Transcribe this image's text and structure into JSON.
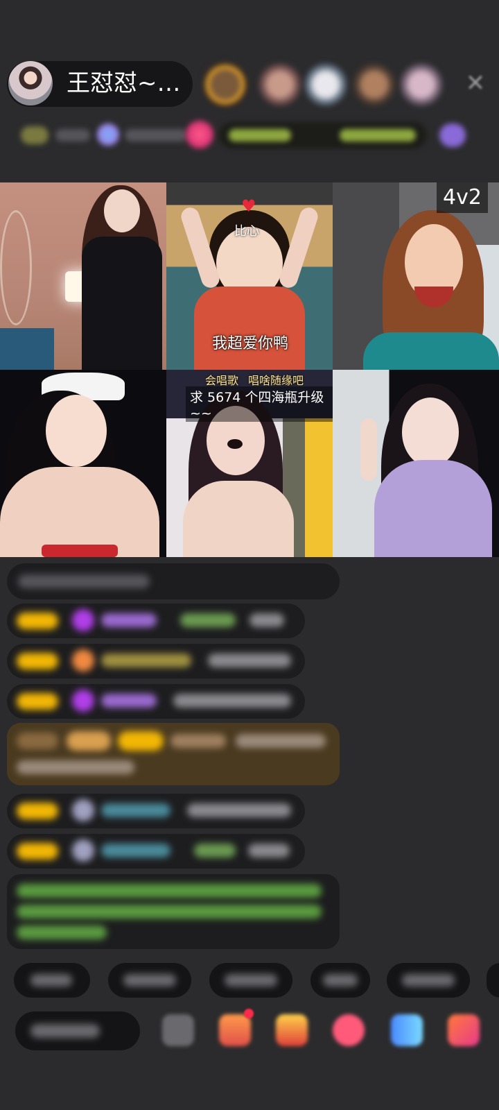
{
  "header": {
    "host_name": "王怼怼~…",
    "close_glyph": "✕"
  },
  "video_grid": {
    "mode_tag": "4v2",
    "tile2": {
      "sticker": "比心",
      "caption": "我超爱你鸭"
    },
    "tile5": {
      "banner_left": "会唱歌",
      "banner_right": "唱啥随缘吧",
      "banner_main": "求 5674 个四海瓶升级~~"
    }
  },
  "colors": {
    "background": "#2b2b2d",
    "pill": "#161618",
    "accent_gold": "#f2b705",
    "chat_green": "#7fd46b",
    "chat_purple": "#b36cff"
  }
}
